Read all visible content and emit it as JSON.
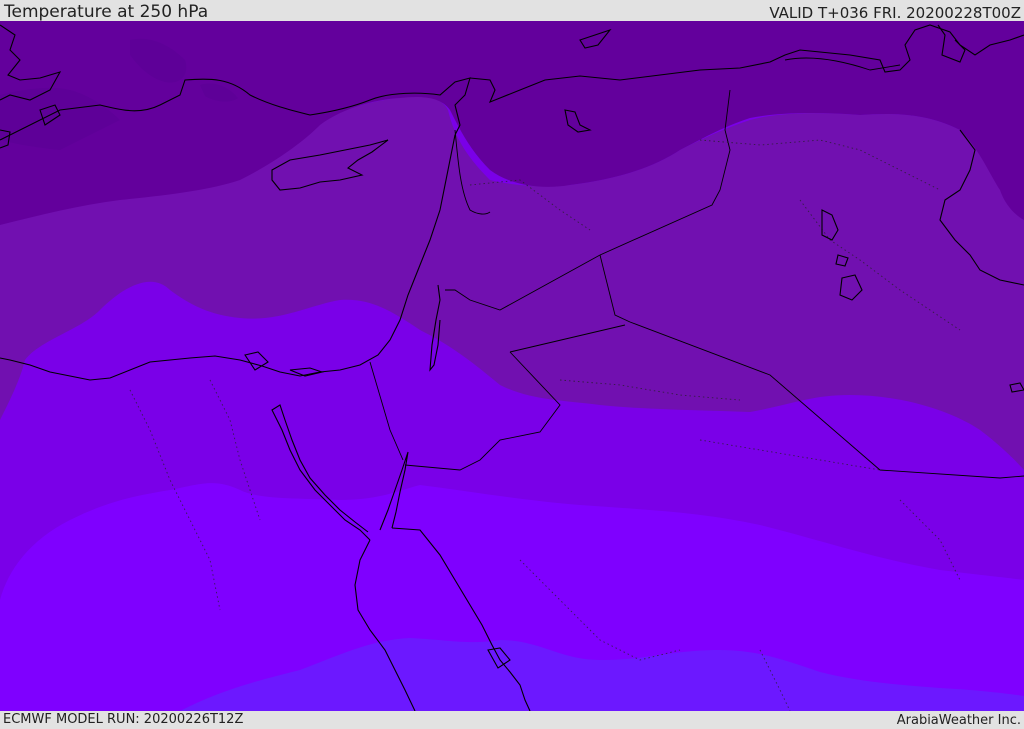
{
  "header": {
    "title": "Temperature at 250 hPa",
    "valid": "VALID T+036 FRI. 20200228T00Z"
  },
  "footer": {
    "model_run": "ECMWF MODEL RUN: 20200226T12Z",
    "credit": "ArabiaWeather Inc."
  },
  "map": {
    "variable": "temperature",
    "level": "250 hPa",
    "colors": {
      "band_darkest": "#5e0098",
      "band_dark": "#63009c",
      "band_mid_dark": "#7110b0",
      "band_mid": "#7a00e8",
      "band_light": "#7f00ff",
      "band_lightest": "#6c18ff",
      "coastline": "#000000"
    }
  }
}
